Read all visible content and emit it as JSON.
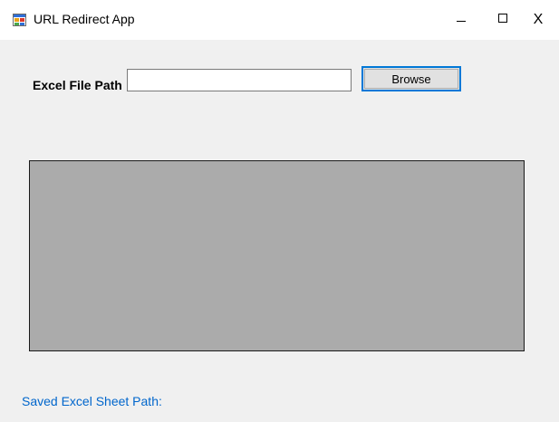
{
  "window": {
    "title": "URL Redirect App",
    "app_icon": "windows-form-icon",
    "controls": {
      "minimize_icon": "minimize-icon",
      "maximize_icon": "maximize-icon",
      "close_glyph": "X"
    }
  },
  "form": {
    "excel_label": "Excel File Path",
    "path_input": {
      "value": "",
      "placeholder": ""
    },
    "browse_label": "Browse",
    "saved_path_label": "Saved Excel Sheet Path:"
  },
  "colors": {
    "form_background": "#f0f0f0",
    "grid_background": "#ababab",
    "accent_blue": "#0078d7",
    "link_blue": "#0066cc"
  }
}
